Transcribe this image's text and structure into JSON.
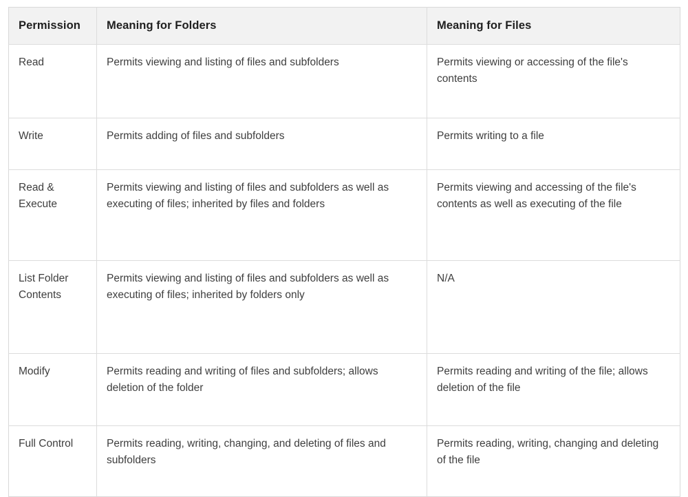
{
  "table": {
    "caption": "",
    "columns": [
      {
        "key": "permission",
        "label": "Permission"
      },
      {
        "key": "folders",
        "label": "Meaning for Folders"
      },
      {
        "key": "files",
        "label": "Meaning for Files"
      }
    ],
    "rows": [
      {
        "permission": "Read",
        "folders": "Permits viewing and listing of files and subfolders",
        "files": "Permits viewing or accessing of the file's contents"
      },
      {
        "permission": "Write",
        "folders": "Permits adding of files and subfolders",
        "files": "Permits writing to a file"
      },
      {
        "permission": "Read & Execute",
        "folders": "Permits viewing and listing of files and subfolders as well as executing of files; inherited by files and folders",
        "files": "Permits viewing and accessing of the file's contents as well as executing of the file"
      },
      {
        "permission": "List Folder Contents",
        "folders": "Permits viewing and listing of files and subfolders as well as executing of files; inherited by folders only",
        "files": "N/A"
      },
      {
        "permission": "Modify",
        "folders": "Permits reading and writing of files and subfolders; allows deletion of the folder",
        "files": "Permits reading and writing of the file; allows deletion of the file"
      },
      {
        "permission": "Full Control",
        "folders": "Permits reading, writing, changing, and deleting of files and subfolders",
        "files": "Permits reading, writing, changing and deleting of the file"
      }
    ]
  },
  "colors": {
    "header_background": "#f2f2f2",
    "header_text": "#1f1f1f",
    "body_text": "#3e3e3e",
    "border": "#dcdcdc",
    "page_background": "#ffffff"
  }
}
